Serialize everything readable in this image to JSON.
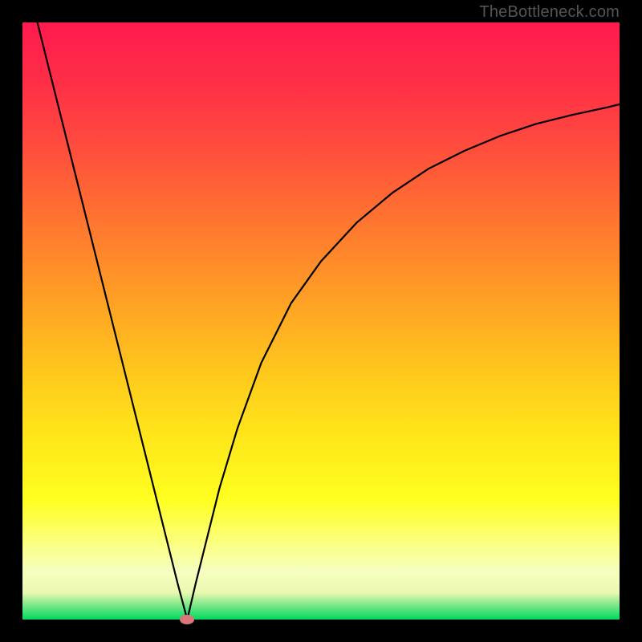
{
  "watermark": "TheBottleneck.com",
  "chart_data": {
    "type": "line",
    "title": "",
    "xlabel": "",
    "ylabel": "",
    "xlim": [
      0,
      100
    ],
    "ylim": [
      0,
      100
    ],
    "grid": false,
    "background_gradient": {
      "stops": [
        {
          "pos": 0.0,
          "color": "#ff1a4e"
        },
        {
          "pos": 0.1,
          "color": "#ff2e47"
        },
        {
          "pos": 0.2,
          "color": "#ff4a3e"
        },
        {
          "pos": 0.3,
          "color": "#ff6a33"
        },
        {
          "pos": 0.4,
          "color": "#ff8b2a"
        },
        {
          "pos": 0.5,
          "color": "#ffac22"
        },
        {
          "pos": 0.6,
          "color": "#ffcc1c"
        },
        {
          "pos": 0.7,
          "color": "#ffe81a"
        },
        {
          "pos": 0.8,
          "color": "#ffff20"
        },
        {
          "pos": 0.86,
          "color": "#fbff70"
        },
        {
          "pos": 0.92,
          "color": "#f6ffc0"
        },
        {
          "pos": 0.955,
          "color": "#eaf8b0"
        },
        {
          "pos": 0.975,
          "color": "#7fe88a"
        },
        {
          "pos": 1.0,
          "color": "#00d860"
        }
      ]
    },
    "series": [
      {
        "name": "left-branch",
        "x": [
          2.5,
          4,
          6,
          8,
          10,
          12,
          14,
          16,
          18,
          20,
          22,
          24,
          26,
          27.6
        ],
        "y": [
          100,
          94,
          86,
          78,
          70,
          62,
          54,
          46,
          38,
          30,
          22,
          14,
          6,
          0
        ]
      },
      {
        "name": "right-branch",
        "x": [
          27.6,
          29,
          31,
          33,
          36,
          40,
          45,
          50,
          56,
          62,
          68,
          74,
          80,
          86,
          92,
          98,
          100
        ],
        "y": [
          0,
          6,
          14,
          22,
          32,
          43,
          53,
          60,
          66.5,
          71.5,
          75.5,
          78.5,
          81,
          83,
          84.5,
          85.8,
          86.3
        ]
      }
    ],
    "marker": {
      "x": 27.6,
      "y": 0
    }
  }
}
